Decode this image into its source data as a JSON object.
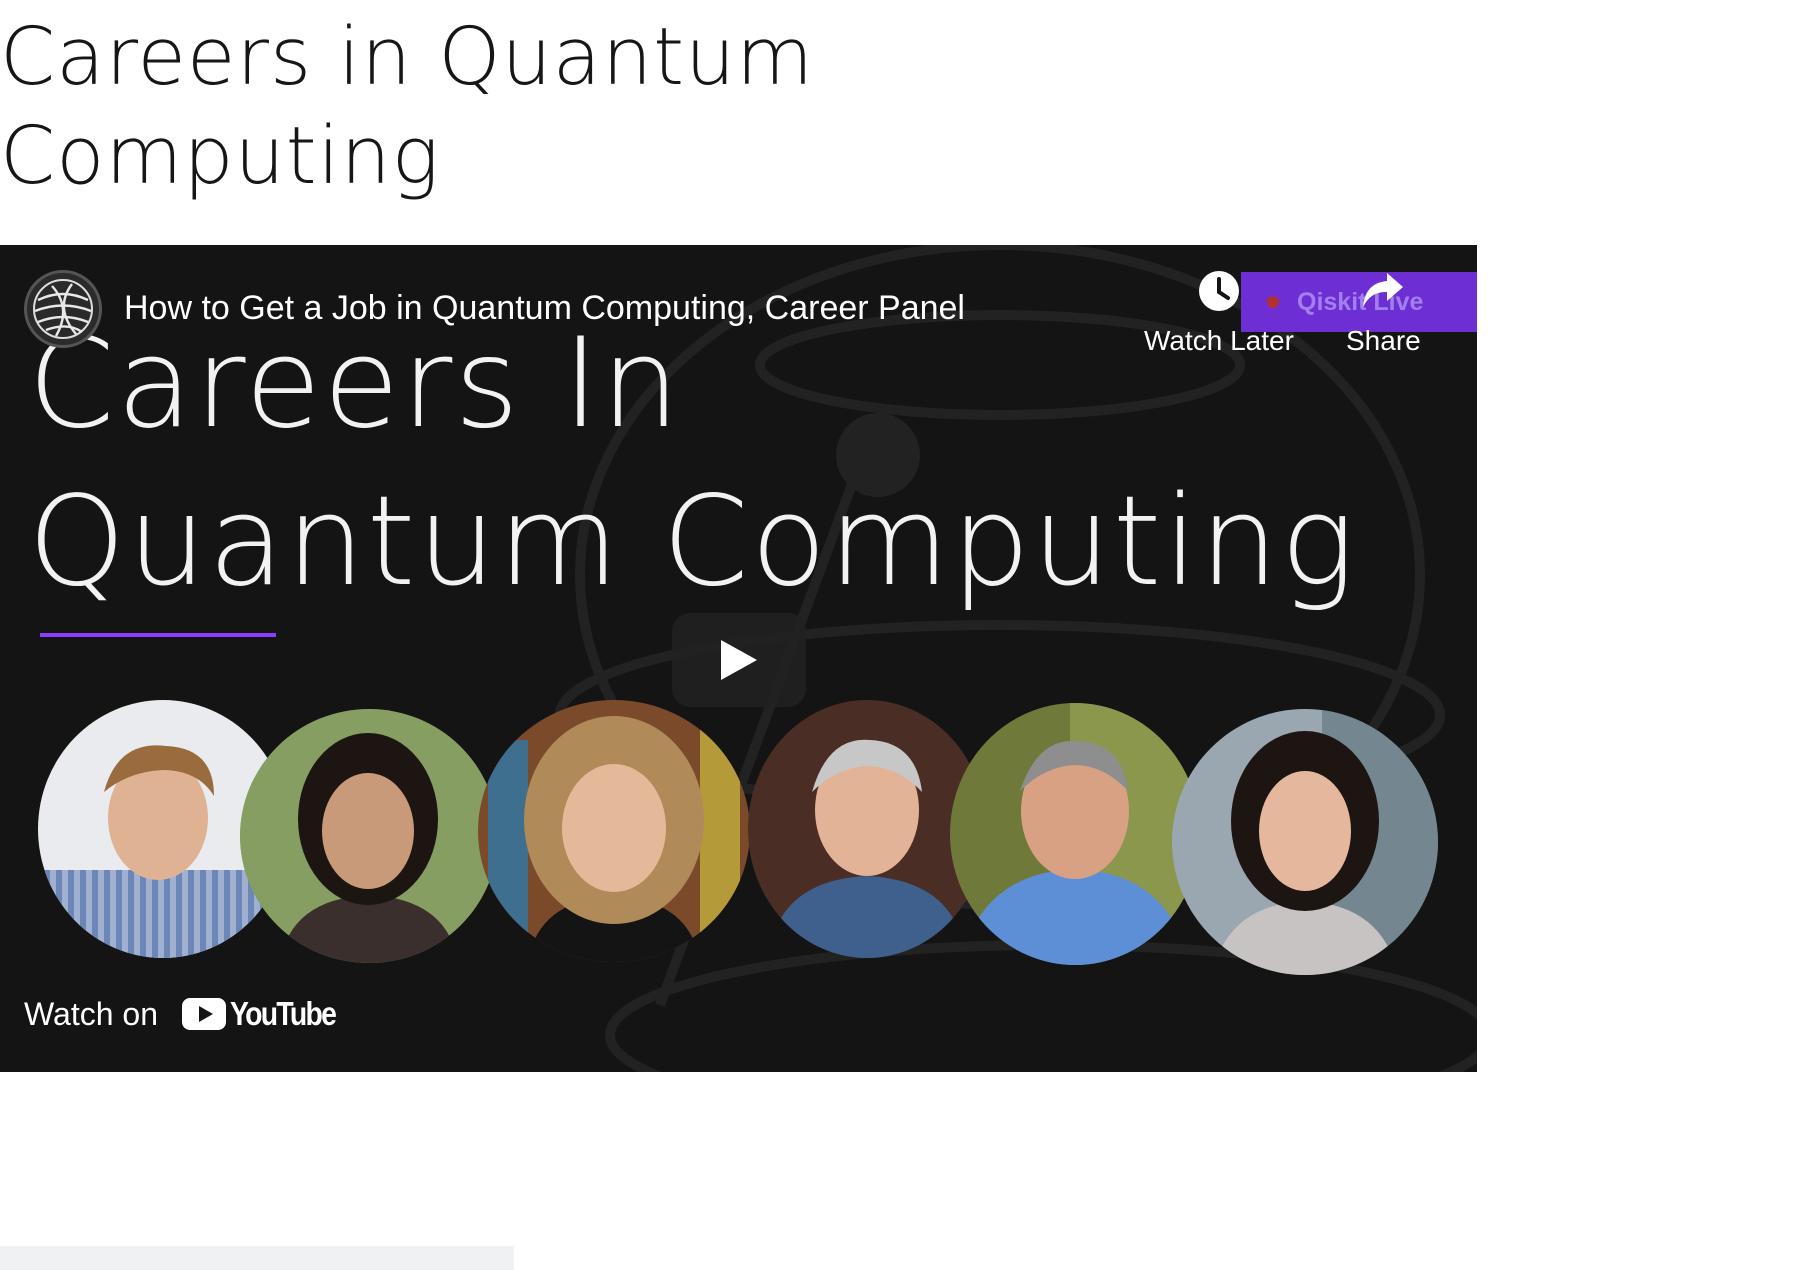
{
  "page": {
    "title_line1": "Careers in Quantum",
    "title_line2": "Computing"
  },
  "video": {
    "title": "How to Get a Job in Quantum Computing, Career Panel",
    "thumbnail_heading_line1": "Careers In",
    "thumbnail_heading_line2": "Quantum Computing",
    "live_banner": "Qiskit Live",
    "channel_icon": "globe-icon",
    "actions": {
      "watch_later": "Watch Later",
      "share": "Share"
    },
    "watch_on": "Watch on",
    "youtube_wordmark": "YouTube",
    "panelist_count": 6
  },
  "colors": {
    "accent_purple": "#8a3ffc",
    "banner_purple": "#6d2fd3",
    "video_bg": "#141414",
    "youtube_red": "#ffffff"
  }
}
